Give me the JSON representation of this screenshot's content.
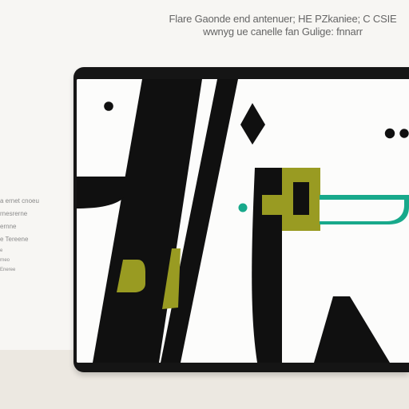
{
  "header": {
    "line_1": "Flare Gaonde end antenuer; HE PZkaniee; C CSIE",
    "line_2": "wwnyg ue canelle fan Gulige: fnnarr"
  },
  "side_notes": [
    "a ernet cnoeu",
    "rnesrerne",
    "ernne",
    "e Tereene",
    "e",
    "rneo",
    "Eneree"
  ],
  "colors": {
    "background": "#f7f6f3",
    "device_frame": "#151515",
    "screen": "#fcfcfb",
    "black": "#101010",
    "olive": "#9a9d21",
    "teal": "#18a98b"
  }
}
